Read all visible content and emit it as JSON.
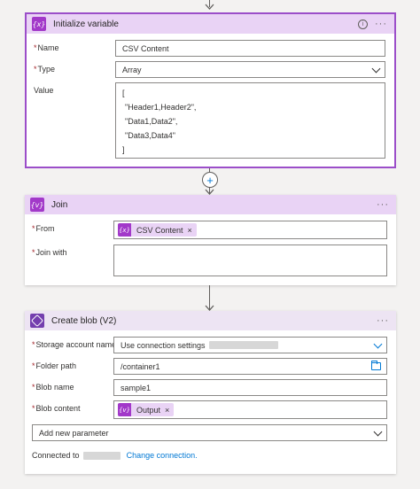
{
  "initialize_variable": {
    "title": "Initialize variable",
    "icon": "{x}",
    "fields": {
      "name_label": "Name",
      "name_value": "CSV Content",
      "type_label": "Type",
      "type_value": "Array",
      "value_label": "Value",
      "value_lines": [
        "[",
        "\"Header1,Header2\",",
        "\"Data1,Data2\",",
        "\"Data3,Data4\"",
        "]"
      ]
    },
    "info_icon": "i"
  },
  "join": {
    "title": "Join",
    "icon": "{v}",
    "from_label": "From",
    "from_token": "CSV Content",
    "token_icon": "{x}",
    "join_with_label": "Join with",
    "join_with_value": ""
  },
  "create_blob": {
    "title": "Create blob (V2)",
    "storage_label": "Storage account name",
    "storage_value": "Use connection settings",
    "folder_label": "Folder path",
    "folder_value": "/container1",
    "blob_name_label": "Blob name",
    "blob_name_value": "sample1",
    "blob_content_label": "Blob content",
    "blob_content_token": "Output",
    "content_token_icon": "{v}",
    "add_param_label": "Add new parameter",
    "connected_label": "Connected to",
    "change_connection": "Change connection."
  },
  "required_mark": "*",
  "more_icon": "···",
  "remove_icon": "×",
  "plus": "+",
  "colors": {
    "accent": "#a239c9",
    "selected_border": "#9b4ec9",
    "link": "#0078d4",
    "blob": "#743eae"
  }
}
